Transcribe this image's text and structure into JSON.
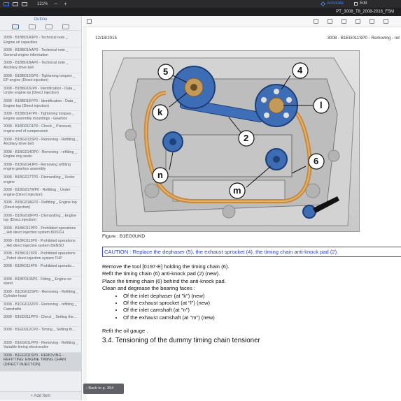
{
  "toolbar": {
    "zoom": "121%",
    "annotate_label": "Annotate",
    "edit_label": "Edit"
  },
  "document": {
    "filename": "PT_3008_T8_2008-2016_FSM"
  },
  "sidebar": {
    "title": "Outline",
    "add_item": "+ Add Item",
    "items": [
      "3008 - B1BB01A9P0 - Technical note _ Engine oil capacities",
      "3008 - B1BB01AAP0 - Technical note _ General engine information",
      "3008 - B1BB01BAP0 - Technical note _ Ancillary drive belt",
      "3008 - B1BB016GP0 - Tightening torques _ EP engine (Direct injection)",
      "3008 - B1BB018JP0 - Identification - Data _ Under engine ep (Direct injection)",
      "3008 - B1BB018YP0 - Identification - Data _ Engine top (Direct injection)",
      "3008 - B1BB0147P0 - Tightening torques _ Engine assembly mountings - Gearbox",
      "3008 - B1BD01D1P0 - Check _ Pressure, engine end of compression",
      "3008 - B1BG013SP0 - Removing - Refitting _ Ancillary drive belt",
      "3008 - B1BG014DP0 - Removing - refitting _ Engine ring seals",
      "3008 - B1BG014JP0 - Removing refitting engine gearbox assembly",
      "3008 - B1BG017TP0 - Dismantling _ Under engine",
      "3008 - B1BG017WP0 - Refitting _ Under engine (Direct injection)",
      "3008 - B1BG018EP0 - Refitting _ Engine top (Direct injection)",
      "3008 - B1BG018FP0 - Dismantling _ Engine top (Direct injection)",
      "3008 - B1BK011PP0 - Prohibited operations _ Hdi direct injection system BOSCH",
      "3008 - B1BK0112P0 - Prohibited operations _ Hdi direct injection system DENSO",
      "3008 - B1BK0113P0 - Prohibited operations _ Petrol direct injection system THP",
      "3008 - B1BK0114P0 - Prohibited operatio...",
      "3008 - B1BP0106P0 - Fitting _ Engine on stand",
      "3008 - B1DG012SP0 - Removing - Refitting _ Cylinder head",
      "3008 - B1DG013ZP0 - Removing - refitting _ Camshafts",
      "3008 - B1ED011PP0 - Check _ Setting the...",
      "3008 - B1ED012CP0 - Timing _ Setting th...",
      "3008 - B1EG01LPP0 - Removing - Refitting _ Variable timing electrovalve",
      "3008 - B1EG011SP0 - REMOVING - REFITTING: ENGINE TIMING CHAIN (DIRECT INJECTION)"
    ]
  },
  "page": {
    "date": "12/18/2015",
    "header_right": "3008 - B1EG011SP0 - Removing - ret",
    "figure_caption": "Figure : B1EG0UKD",
    "caution": "CAUTION : Replace the dephaser (5), the exhaust sprocket (4), the timing chain anti-knock pad (2).",
    "lines": [
      "Remove the tool [0197-E] holding the timing chain (6).",
      "Refit the timing chain (6) anti-knock pad (2) (new).",
      "Place the timing chain (6) behind the anti-knock pad.",
      "Clean and degrease the bearing faces :"
    ],
    "bullets": [
      "Of the inlet dephaser (at \"k\") (new)",
      "Of the exhaust sprocket (at \"l\") (new)",
      "Of the inlet camshaft (at \"n\")",
      "Of the exhaust camshaft (at \"m\") (new)"
    ],
    "refit": "Refit the oil gauge .",
    "section": "3.4. Tensioning of the dummy timing chain tensioner",
    "callouts": [
      "5",
      "4",
      "k",
      "2",
      "l",
      "6",
      "n",
      "m"
    ]
  },
  "back_button": "Back to p. 354"
}
